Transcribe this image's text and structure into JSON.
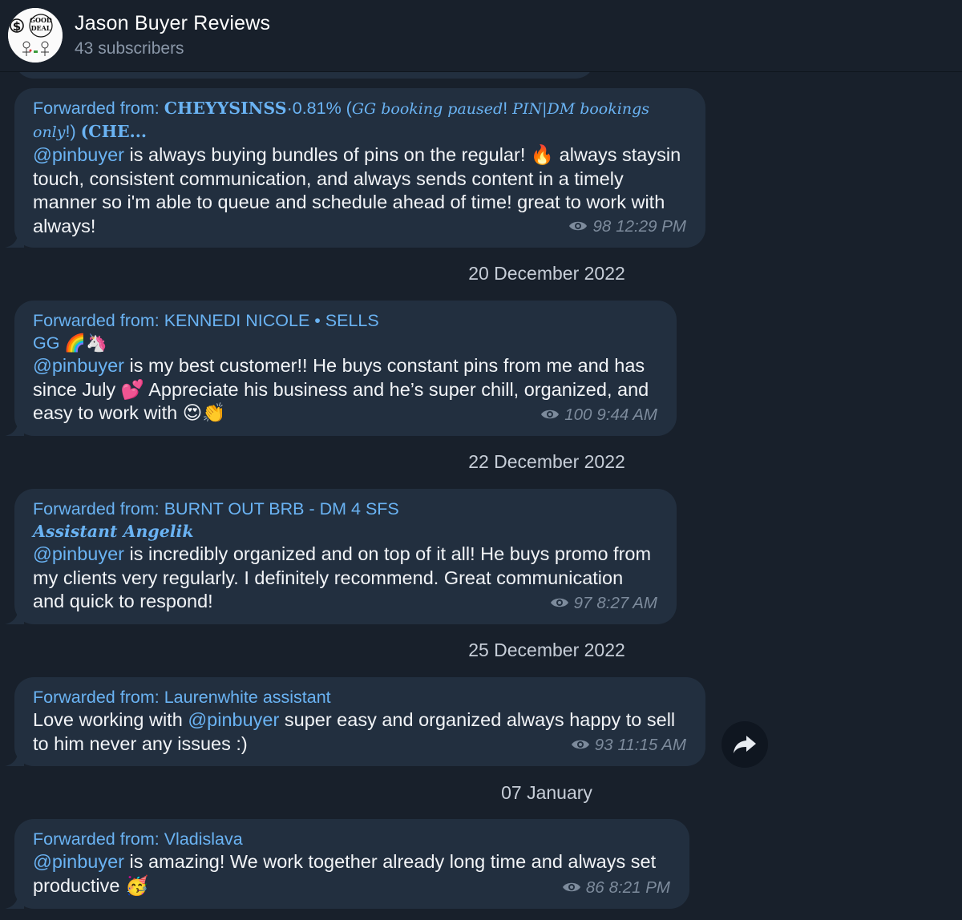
{
  "header": {
    "title": "Jason Buyer Reviews",
    "subscribers": "43 subscribers",
    "avatar_text_top": "GOOD",
    "avatar_text_bottom": "DEAL"
  },
  "fwd_prefix": "Forwarded from:",
  "messages": [
    {
      "source_a": "CHEYYSINSS",
      "source_b": "·0.81% (",
      "source_c": "GG booking paused",
      "source_d": "! ",
      "source_e": "PIN|DM bookings only",
      "source_f": "!) ",
      "source_g": "(CHE...",
      "mention": "@pinbuyer",
      "text": " is always buying bundles of pins on the regular! 🔥 always staysin touch, consistent communication, and always sends content in a timely manner so i'm able to queue and schedule ahead of time! great to work with always!",
      "views": "98",
      "time": "12:29 PM"
    },
    {
      "date": "20 December 2022",
      "source": "KENNEDI NICOLE • SELLS GG 🌈🦄",
      "mention": "@pinbuyer",
      "text": " is my best customer!! He buys constant pins from me and has since July 💕 Appreciate his business and he’s super chill, organized, and easy to work with 😍👏",
      "views": "100",
      "time": "9:44 AM"
    },
    {
      "date": "22 December 2022",
      "source": "BURNT OUT BRB - DM 4 SFS",
      "source_fancy": "Assistant Angelik",
      "mention": "@pinbuyer",
      "text": " is incredibly organized and on top of it all! He buys promo from my clients very regularly. I definitely recommend. Great communication and quick to respond!",
      "views": "97",
      "time": "8:27 AM"
    },
    {
      "date": "25 December 2022",
      "source": "Laurenwhite assistant",
      "text_before": "Love working with ",
      "mention": "@pinbuyer",
      "text": " super easy and organized always happy to sell to him never any issues :)",
      "views": "93",
      "time": "11:15 AM"
    },
    {
      "date": "07 January",
      "source": "Vladislava",
      "mention": "@pinbuyer",
      "text": " is amazing! We work together already long time and always set productive 🥳",
      "views": "86",
      "time": "8:21 PM"
    }
  ],
  "icons": {
    "eye": "eye-icon",
    "share": "share-arrow-icon"
  },
  "colors": {
    "background": "#18202b",
    "bubble": "#222f3f",
    "link": "#6ab3f3",
    "meta": "#7d8b9c"
  }
}
